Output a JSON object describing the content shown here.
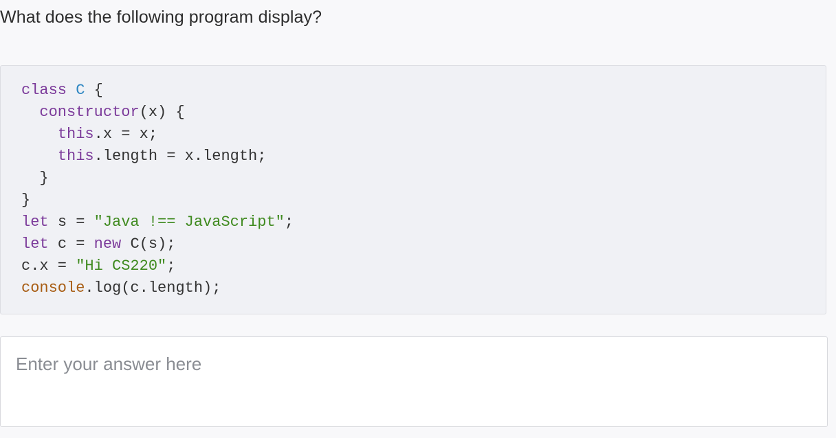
{
  "question": {
    "text": "What does the following program display?"
  },
  "code": {
    "lines": [
      [
        {
          "t": "class ",
          "c": "kw"
        },
        {
          "t": "C",
          "c": "cls"
        },
        {
          "t": " {",
          "c": "plain"
        }
      ],
      [
        {
          "t": "  constructor",
          "c": "kw"
        },
        {
          "t": "(x) {",
          "c": "plain"
        }
      ],
      [
        {
          "t": "    ",
          "c": "plain"
        },
        {
          "t": "this",
          "c": "kw"
        },
        {
          "t": ".x = x;",
          "c": "plain"
        }
      ],
      [
        {
          "t": "    ",
          "c": "plain"
        },
        {
          "t": "this",
          "c": "kw"
        },
        {
          "t": ".length = x.length;",
          "c": "plain"
        }
      ],
      [
        {
          "t": "  }",
          "c": "plain"
        }
      ],
      [
        {
          "t": "}",
          "c": "plain"
        }
      ],
      [
        {
          "t": "let ",
          "c": "kw"
        },
        {
          "t": "s = ",
          "c": "plain"
        },
        {
          "t": "\"Java !== JavaScript\"",
          "c": "str"
        },
        {
          "t": ";",
          "c": "plain"
        }
      ],
      [
        {
          "t": "let ",
          "c": "kw"
        },
        {
          "t": "c = ",
          "c": "plain"
        },
        {
          "t": "new ",
          "c": "kw"
        },
        {
          "t": "C(s);",
          "c": "plain"
        }
      ],
      [
        {
          "t": "c.x = ",
          "c": "plain"
        },
        {
          "t": "\"Hi CS220\"",
          "c": "str"
        },
        {
          "t": ";",
          "c": "plain"
        }
      ],
      [
        {
          "t": "console",
          "c": "builtin"
        },
        {
          "t": ".log(c.length);",
          "c": "plain"
        }
      ]
    ]
  },
  "answer": {
    "value": "",
    "placeholder": "Enter your answer here"
  }
}
